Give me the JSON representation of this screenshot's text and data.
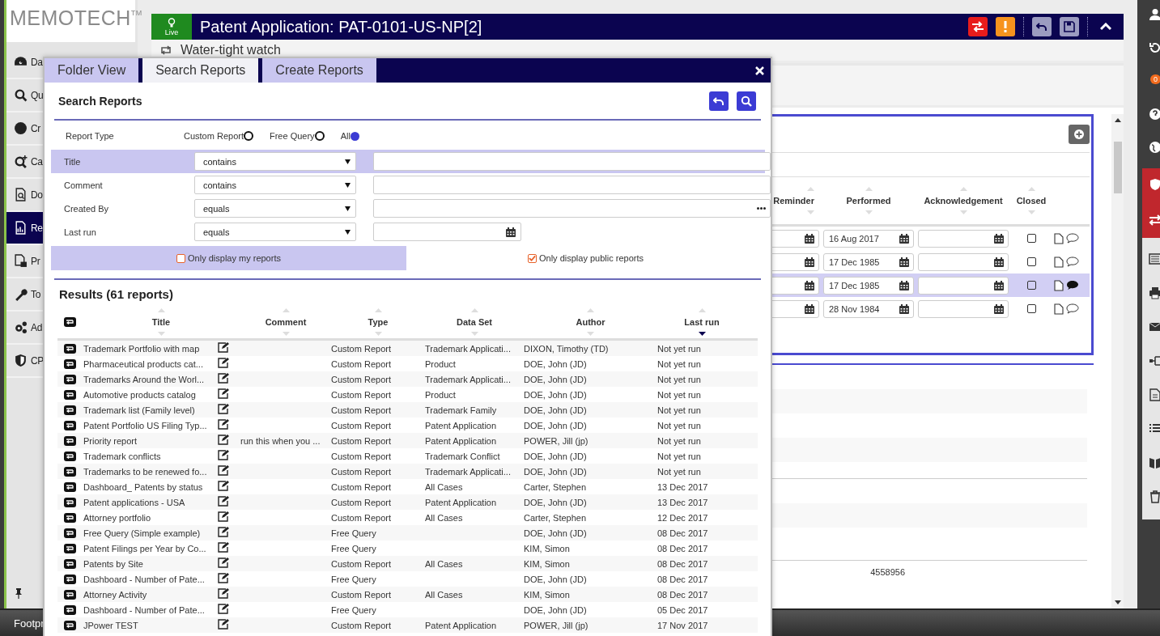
{
  "brand": {
    "name": "MEMOTECH",
    "mark": "TM"
  },
  "sidebar": {
    "items": [
      {
        "label": "Da",
        "selected": false
      },
      {
        "label": "Qu",
        "selected": false
      },
      {
        "label": "Cr",
        "selected": false
      },
      {
        "label": "Ca",
        "selected": false
      },
      {
        "label": "Do",
        "selected": false
      },
      {
        "label": "Re",
        "selected": true
      },
      {
        "label": "Pr",
        "selected": false
      },
      {
        "label": "To",
        "selected": false
      },
      {
        "label": "Ad",
        "selected": false
      },
      {
        "label": "CP",
        "selected": false
      }
    ]
  },
  "record": {
    "status": "Live",
    "title": "Patent Application: PAT-0101-US-NP[2]",
    "subtitle": "Water-tight watch"
  },
  "panel": {
    "columns": [
      {
        "label": "Reminder"
      },
      {
        "label": "Performed"
      },
      {
        "label": "Acknowledgement"
      },
      {
        "label": "Closed"
      }
    ],
    "rows": [
      {
        "performed": "16 Aug 2017",
        "closed": false,
        "has_comments": false,
        "selected": false
      },
      {
        "performed": "17 Dec 1985",
        "closed": false,
        "has_comments": false,
        "selected": false
      },
      {
        "performed": "17 Dec 1985",
        "closed": false,
        "has_comments": true,
        "selected": true
      },
      {
        "performed": "28 Nov 1984",
        "closed": false,
        "has_comments": false,
        "selected": false
      }
    ],
    "footer_value": "4558956"
  },
  "rail": {
    "notification_count": "0"
  },
  "dialog": {
    "tabs": [
      {
        "label": "Folder View",
        "selected": false
      },
      {
        "label": "Search Reports",
        "selected": true
      },
      {
        "label": "Create Reports",
        "selected": false
      }
    ],
    "title": "Search Reports",
    "report_type": {
      "label": "Report Type",
      "options": [
        {
          "label": "Custom Report",
          "selected": false
        },
        {
          "label": "Free Query",
          "selected": false
        },
        {
          "label": "All",
          "selected": true
        }
      ]
    },
    "filters": [
      {
        "label": "Title",
        "operator": "contains",
        "kind": "text",
        "highlighted": true
      },
      {
        "label": "Comment",
        "operator": "contains",
        "kind": "text",
        "highlighted": false
      },
      {
        "label": "Created By",
        "operator": "equals",
        "kind": "lookup",
        "highlighted": false
      },
      {
        "label": "Last run",
        "operator": "equals",
        "kind": "date",
        "highlighted": false
      }
    ],
    "options": [
      {
        "label": "Only display my reports",
        "checked": false,
        "highlighted": true
      },
      {
        "label": "Only display public reports",
        "checked": true,
        "highlighted": false
      }
    ],
    "results": {
      "title": "Results (61 reports)",
      "columns": [
        {
          "label": "Title",
          "sorted": false
        },
        {
          "label": "Comment",
          "sorted": false
        },
        {
          "label": "Type",
          "sorted": false
        },
        {
          "label": "Data Set",
          "sorted": false
        },
        {
          "label": "Author",
          "sorted": false
        },
        {
          "label": "Last run",
          "sorted": true
        }
      ],
      "rows": [
        [
          "Trademark Portfolio with map",
          "",
          "Custom Report",
          "Trademark Applicati...",
          "DIXON, Timothy (TD)",
          "Not yet run"
        ],
        [
          "Pharmaceutical products cat...",
          "",
          "Custom Report",
          "Product",
          "DOE, John (JD)",
          "Not yet run"
        ],
        [
          "Trademarks Around the Worl...",
          "",
          "Custom Report",
          "Trademark Applicati...",
          "DOE, John (JD)",
          "Not yet run"
        ],
        [
          "Automotive products catalog",
          "",
          "Custom Report",
          "Product",
          "DOE, John (JD)",
          "Not yet run"
        ],
        [
          "Trademark list (Family level)",
          "",
          "Custom Report",
          "Trademark Family",
          "DOE, John (JD)",
          "Not yet run"
        ],
        [
          "Patent Portfolio US Filing Typ...",
          "",
          "Custom Report",
          "Patent Application",
          "DOE, John (JD)",
          "Not yet run"
        ],
        [
          "Priority report",
          "run this when you ...",
          "Custom Report",
          "Patent Application",
          "POWER, Jill (jp)",
          "Not yet run"
        ],
        [
          "Trademark conflicts",
          "",
          "Custom Report",
          "Trademark Conflict",
          "DOE, John (JD)",
          "Not yet run"
        ],
        [
          "Trademarks to be renewed fo...",
          "",
          "Custom Report",
          "Trademark Applicati...",
          "DOE, John (JD)",
          "Not yet run"
        ],
        [
          "Dashboard_ Patents by status",
          "",
          "Custom Report",
          "All Cases",
          "Carter, Stephen",
          "13 Dec 2017"
        ],
        [
          "Patent applications - USA",
          "",
          "Custom Report",
          "Patent Application",
          "DOE, John (JD)",
          "13 Dec 2017"
        ],
        [
          "Attorney portfolio",
          "",
          "Custom Report",
          "All Cases",
          "Carter, Stephen",
          "12 Dec 2017"
        ],
        [
          "Free Query (Simple example)",
          "",
          "Free Query",
          "",
          "DOE, John (JD)",
          "08 Dec 2017"
        ],
        [
          "Patent Filings per Year by Co...",
          "",
          "Free Query",
          "",
          "KIM, Simon",
          "08 Dec 2017"
        ],
        [
          "Patents by Site",
          "",
          "Custom Report",
          "All Cases",
          "KIM, Simon",
          "08 Dec 2017"
        ],
        [
          "Dashboard - Number of Pate...",
          "",
          "Free Query",
          "",
          "DOE, John (JD)",
          "08 Dec 2017"
        ],
        [
          "Attorney Activity",
          "",
          "Custom Report",
          "All Cases",
          "KIM, Simon",
          "08 Dec 2017"
        ],
        [
          "Dashboard - Number of Pate...",
          "",
          "Free Query",
          "",
          "DOE, John (JD)",
          "05 Dec 2017"
        ],
        [
          "JPower TEST",
          "",
          "Custom Report",
          "Patent Application",
          "POWER, Jill (jp)",
          "17 Nov 2017"
        ]
      ]
    }
  },
  "taskbar": {
    "label": "Footpr"
  }
}
